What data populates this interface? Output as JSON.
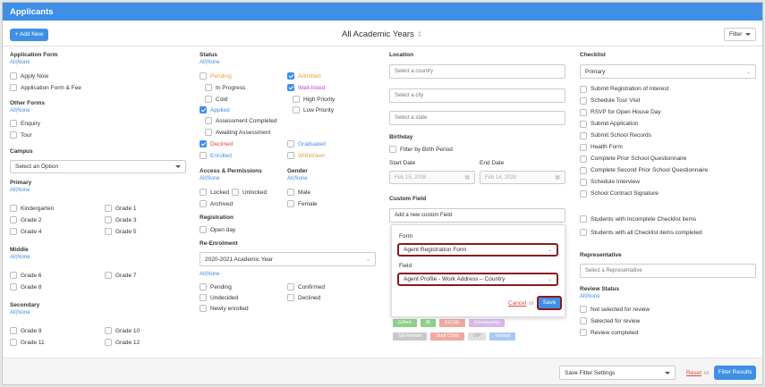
{
  "header": {
    "title": "Applicants"
  },
  "toolbar": {
    "add_new": "+ Add New",
    "year": "All Academic Years",
    "filter": "Filter"
  },
  "allnone": {
    "all": "All",
    "sep": "|",
    "none": "None"
  },
  "col1": {
    "application_form": {
      "title": "Application Form",
      "items": [
        "Apply Now",
        "Application Form & Fee"
      ]
    },
    "other_forms": {
      "title": "Other Forms",
      "items": [
        "Enquiry",
        "Tour"
      ]
    },
    "campus": {
      "title": "Campus",
      "select": "Select an Option"
    },
    "primary": {
      "title": "Primary",
      "left": [
        "Kindergarten",
        "Grade 2",
        "Grade 4"
      ],
      "right": [
        "Grade 1",
        "Grade 3",
        "Grade 5"
      ]
    },
    "middle": {
      "title": "Middle",
      "left": [
        "Grade 6",
        "Grade 8"
      ],
      "right": [
        "Grade 7"
      ]
    },
    "secondary": {
      "title": "Secondary",
      "left": [
        "Grade 9",
        "Grade 11"
      ],
      "right": [
        "Grade 10",
        "Grade 12"
      ]
    }
  },
  "col2": {
    "status": {
      "title": "Status",
      "pending": "Pending",
      "in_progress": "In Progress",
      "cold": "Cold",
      "applied": "Applied",
      "assessment_completed": "Assessment Completed",
      "awaiting_assessment": "Awaiting Assessment",
      "declined": "Declined",
      "enrolled": "Enrolled",
      "admitted": "Admitted",
      "wait_listed": "Wait-listed",
      "high_priority": "High Priority",
      "low_priority": "Low Priority",
      "graduated": "Graduated",
      "withdrawn": "Withdrawn"
    },
    "access": {
      "title": "Access & Permissions",
      "locked": "Locked",
      "unlocked": "Unlocked",
      "archived": "Archived"
    },
    "gender": {
      "title": "Gender",
      "male": "Male",
      "female": "Female"
    },
    "registration": {
      "title": "Registration",
      "open_day": "Open day"
    },
    "reenrolment": {
      "title": "Re-Enrolment",
      "year": "2020-2021 Academic Year",
      "pending": "Pending",
      "undecided": "Undecided",
      "newly_enrolled": "Newly enrolled",
      "confirmed": "Confirmed",
      "declined": "Declined"
    }
  },
  "col3": {
    "location": {
      "title": "Location",
      "country": "Select a country",
      "city": "Select a city",
      "state": "Select a state"
    },
    "birthday": {
      "title": "Birthday",
      "filter": "Filter by Birth Period",
      "start_label": "Start Date",
      "end_label": "End Date",
      "start": "Feb 15, 2008",
      "end": "Feb 14, 2020"
    },
    "custom": {
      "title": "Custom Field",
      "add": "Add a new custom Field",
      "form_label": "Form",
      "form_value": "Agent Registration Form",
      "field_label": "Field",
      "field_value": "Agent Profile - Work Address – Country",
      "cancel": "Cancel",
      "or": "or",
      "save": "Save"
    },
    "tags": [
      {
        "label": "Gifted",
        "color": "#8fd18a"
      },
      {
        "label": "IB",
        "color": "#8fd18a"
      },
      {
        "label": "iGCSE",
        "color": "#f0a9a0"
      },
      {
        "label": "Scholarship",
        "color": "#d7b8e8"
      },
      {
        "label": "Sib-female",
        "color": "#c9c9c9"
      },
      {
        "label": "Staff Child",
        "color": "#f0a9a0"
      },
      {
        "label": "VIP",
        "color": "#e0e0e0"
      },
      {
        "label": "Visited",
        "color": "#a9c9f0"
      }
    ]
  },
  "col4": {
    "checklist": {
      "title": "Checklist",
      "select": "Primary",
      "items": [
        "Submit Registration of Interest",
        "Schedule Tour Visit",
        "RSVP for Open House Day",
        "Submit Application",
        "Submit School Records",
        "Health Form",
        "Complete Prior School Questionnaire",
        "Complete Second Prior School Questionnaire",
        "Schedule Interview",
        "School Contract Signature"
      ],
      "incomplete": "Students with Incomplete Checklist items",
      "complete": "Students with all Checklist items completed"
    },
    "representative": {
      "title": "Representative",
      "placeholder": "Select a Representative"
    },
    "review": {
      "title": "Review Status",
      "items": [
        "Not selected for review",
        "Selected for review",
        "Review completed"
      ]
    }
  },
  "footer": {
    "save_settings": "Save Filter Settings",
    "reset": "Reset",
    "or": "or",
    "filter_results": "Filter Results"
  },
  "colors": {
    "accent": "#3f8fe6",
    "highlight": "#8b1a1a",
    "pending": "#e8a33c",
    "admitted": "#e8a33c",
    "declined": "#e04a3c",
    "enrolled": "#3f8fe6",
    "graduated": "#3f8fe6",
    "withdrawn": "#e8a33c",
    "wait_listed": "#b04ad0"
  }
}
